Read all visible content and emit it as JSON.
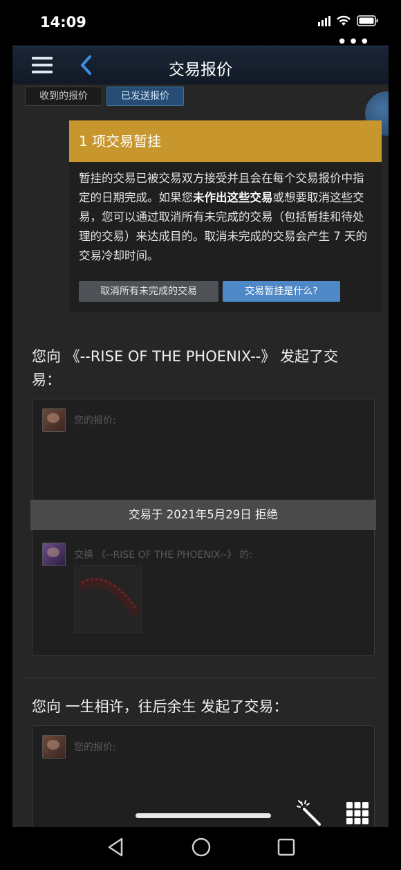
{
  "status_bar": {
    "time": "14:09"
  },
  "nav": {
    "title": "交易报价"
  },
  "tabs": [
    {
      "label": "收到的报价",
      "active": false
    },
    {
      "label": "已发送报价",
      "active": true
    }
  ],
  "notice": {
    "header": "1 项交易暂挂",
    "body_part1": "暂挂的交易已被交易双方接受并且会在每个交易报价中指定的日期完成。如果您",
    "body_bold": "未作出这些交易",
    "body_part2": "或想要取消这些交易，您可以通过取消所有未完成的交易（包括暂挂和待处理的交易）来达成目的。取消未完成的交易会产生 7 天的交易冷却时间。",
    "cancel_all_label": "取消所有未完成的交易",
    "what_is_label": "交易暂挂是什么?"
  },
  "trades": [
    {
      "title": "您向 《--RISE OF THE PHOENIX--》 发起了交易：",
      "your_offer_label": "您的报价:",
      "declined_text": "交易于 2021年5月29日 拒绝",
      "exchange_label": "交换 《--RISE OF THE PHOENIX--》 的:"
    },
    {
      "title": "您向 一生相许，往后余生 发起了交易：",
      "your_offer_label": "您的报价:"
    }
  ],
  "colors": {
    "accent_blue": "#4f88c6",
    "notice_header": "#c7962d",
    "background": "#262626"
  }
}
